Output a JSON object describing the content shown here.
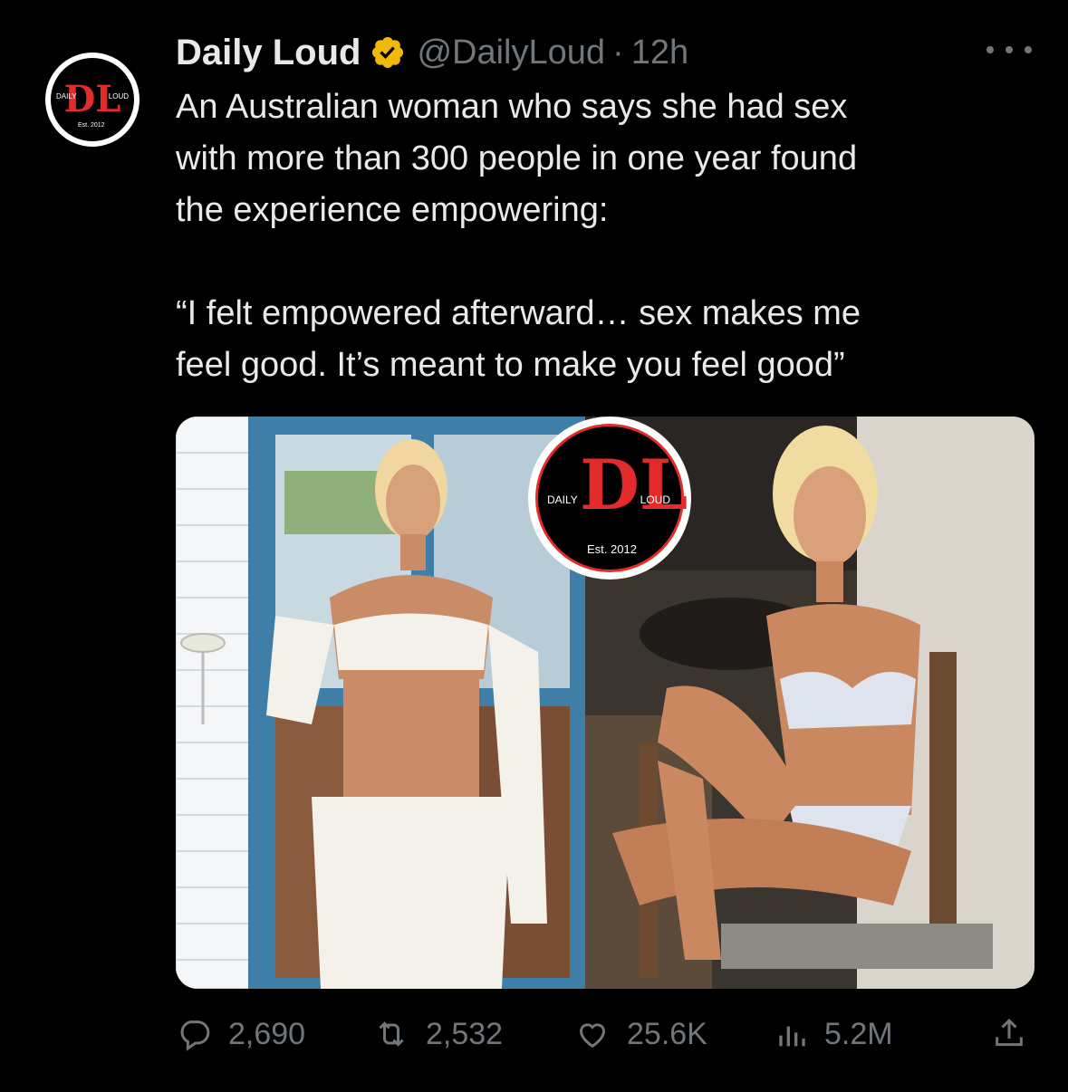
{
  "author": {
    "name": "Daily Loud",
    "handle": "@DailyLoud",
    "separator": "·",
    "time": "12h"
  },
  "logo": {
    "left_word": "DAILY",
    "right_word": "LOUD",
    "est": "Est. 2012",
    "small_est": "Est. 2012"
  },
  "tweet": {
    "lines": [
      "An Australian woman who says she had sex",
      "with more than 300 people in one year found",
      "the experience empowering:",
      "",
      "“I felt empowered afterward… sex makes me",
      "feel good. It’s meant to make you feel good”"
    ]
  },
  "actions": {
    "replies": "2,690",
    "reposts": "2,532",
    "likes": "25.6K",
    "views": "5.2M"
  },
  "colors": {
    "background": "#000000",
    "text": "#e7e9ea",
    "muted": "#71767b",
    "verified_gold": "#f0b90b",
    "brand_red": "#e32b2b"
  },
  "icons": [
    "verified-icon",
    "more-icon",
    "reply-icon",
    "repost-icon",
    "like-icon",
    "views-icon",
    "share-icon"
  ]
}
